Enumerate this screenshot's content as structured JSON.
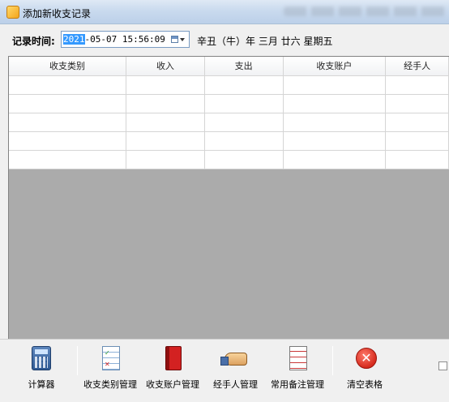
{
  "window": {
    "title": "添加新收支记录"
  },
  "datebar": {
    "label": "记录时间:",
    "date_year": "2021",
    "date_rest": "-05-07 15:56:09",
    "lunar": "辛丑（牛）年 三月 廿六 星期五"
  },
  "grid": {
    "columns": [
      "收支类别",
      "收入",
      "支出",
      "收支账户",
      "经手人"
    ],
    "rows": [
      [
        "",
        "",
        "",
        "",
        ""
      ],
      [
        "",
        "",
        "",
        "",
        ""
      ],
      [
        "",
        "",
        "",
        "",
        ""
      ],
      [
        "",
        "",
        "",
        "",
        ""
      ],
      [
        "",
        "",
        "",
        "",
        ""
      ]
    ]
  },
  "toolbar": {
    "calculator": "计算器",
    "category_mgmt": "收支类别管理",
    "account_mgmt": "收支账户管理",
    "handler_mgmt": "经手人管理",
    "notes_mgmt": "常用备注管理",
    "clear_table": "清空表格"
  },
  "icons": [
    "app-icon",
    "calendar-icon",
    "calculator-icon",
    "category-list-icon",
    "account-book-icon",
    "handler-hand-icon",
    "notes-icon",
    "clear-icon"
  ],
  "colors": {
    "selection": "#3399ff",
    "titlebar": "#c9daee",
    "grid_bg": "#ababab"
  }
}
